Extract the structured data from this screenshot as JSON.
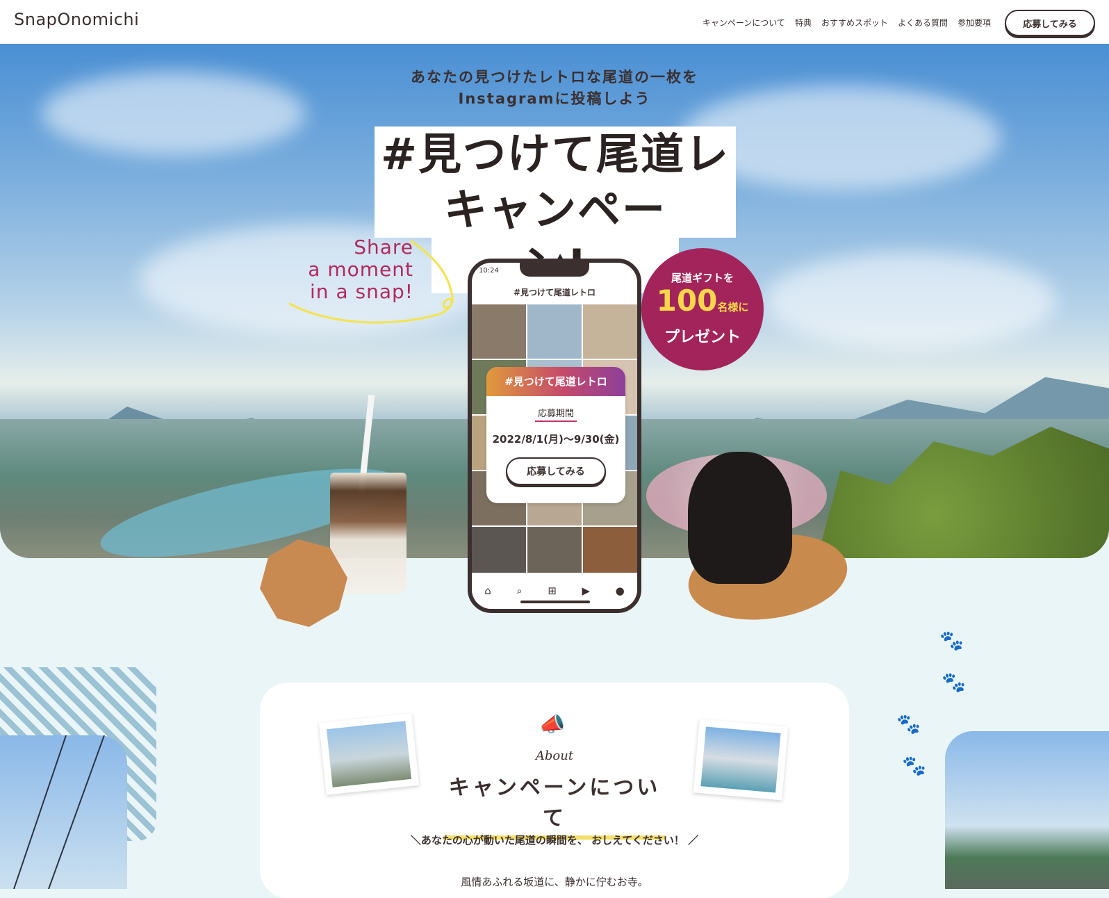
{
  "header": {
    "logo": "SnapOnomichi",
    "nav": [
      "キャンペーンについて",
      "特典",
      "おすすめスポット",
      "よくある質問",
      "参加要項"
    ],
    "cta": "応募してみる"
  },
  "hero": {
    "lead_line1": "あなたの見つけたレトロな尾道の一枚を",
    "lead_line2": "Instagramに投稿しよう",
    "title_line1": "#見つけて尾道レトロ",
    "title_line2": "キャンペーン!",
    "share_text": [
      "Share",
      "a moment",
      "in a snap!"
    ],
    "phone": {
      "time": "10:24",
      "title": "#見つけて尾道レトロ",
      "tab_icons": [
        "home-icon",
        "search-icon",
        "add-icon",
        "reels-icon",
        "profile-icon"
      ]
    },
    "card": {
      "hashtag": "#見つけて尾道レトロ",
      "period_label": "応募期間",
      "period": "2022/8/1(月)〜9/30(金)",
      "button": "応募してみる"
    },
    "gift": {
      "line1": "尾道ギフトを",
      "count": "100",
      "unit": "名様に",
      "line3": "プレゼント"
    }
  },
  "about": {
    "eyebrow": "About",
    "title": "キャンペーンについて",
    "tagline": "＼あなたの心が動いた尾道の瞬間を、 おしえてください！ ／",
    "body": "風情あふれる坂道に、静かに佇むお寺。"
  },
  "colors": {
    "accent": "#a3245a",
    "text": "#3b2f2f",
    "underline": "#f3e06a",
    "page_bg": "#eaf5f7"
  }
}
